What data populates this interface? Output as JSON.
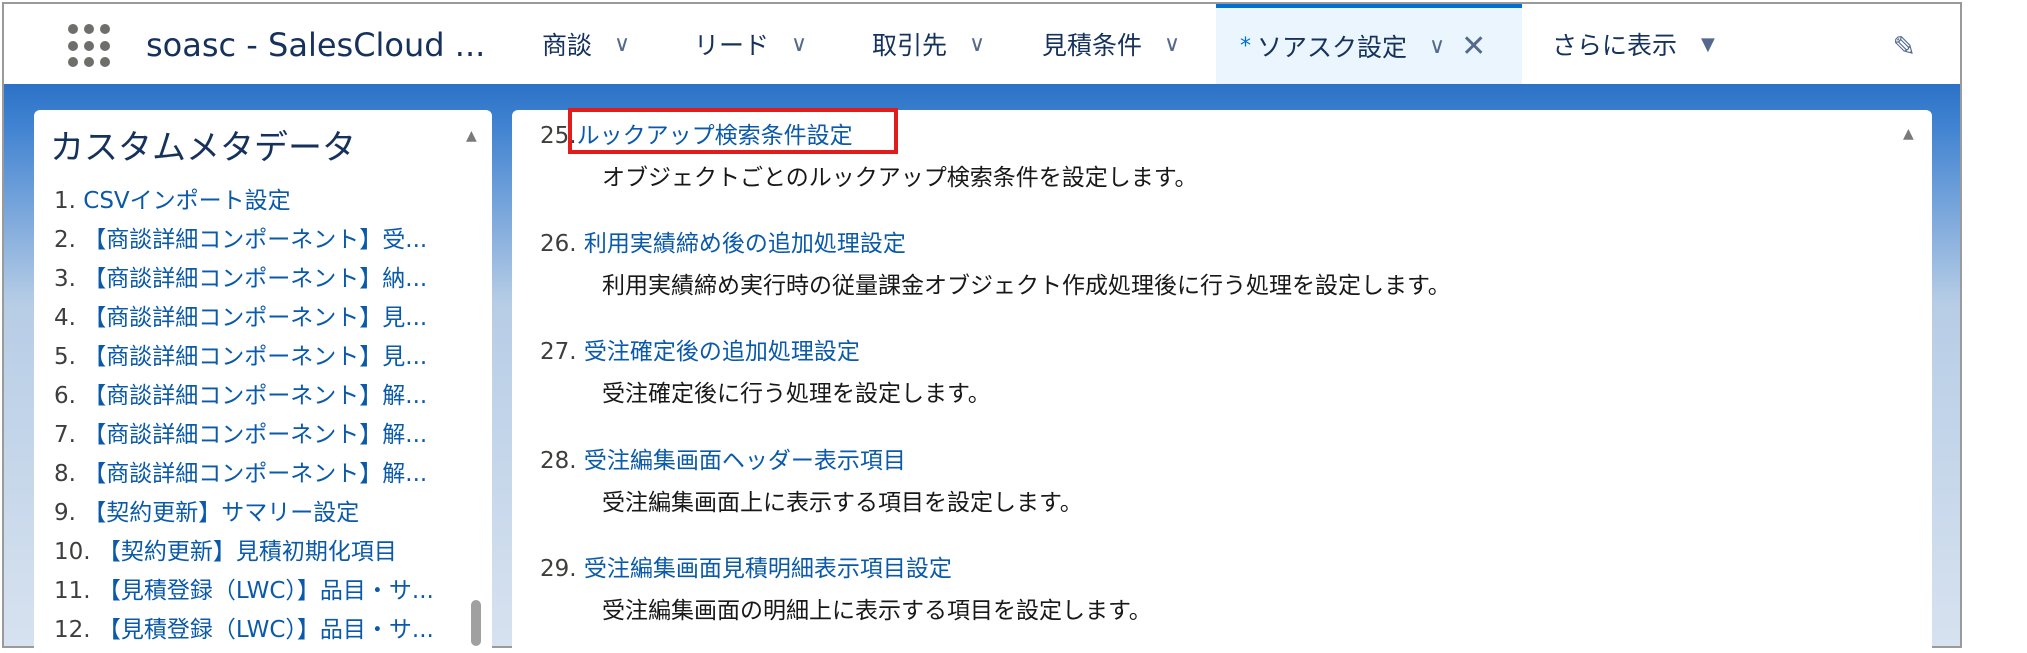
{
  "app": {
    "name": "soasc - SalesCloud ..."
  },
  "tabs": [
    {
      "label": "商談"
    },
    {
      "label": "リード"
    },
    {
      "label": "取引先"
    },
    {
      "label": "見積条件"
    }
  ],
  "active_tab": {
    "marker": "*",
    "label": "ソアスク設定",
    "close": "✕"
  },
  "more_tab": {
    "label": "さらに表示"
  },
  "left": {
    "title": "カスタムメタデータ",
    "items": [
      {
        "num": "1.",
        "label": "CSVインポート設定"
      },
      {
        "num": "2.",
        "label": "【商談詳細コンポーネント】受..."
      },
      {
        "num": "3.",
        "label": "【商談詳細コンポーネント】納..."
      },
      {
        "num": "4.",
        "label": "【商談詳細コンポーネント】見..."
      },
      {
        "num": "5.",
        "label": "【商談詳細コンポーネント】見..."
      },
      {
        "num": "6.",
        "label": "【商談詳細コンポーネント】解..."
      },
      {
        "num": "7.",
        "label": "【商談詳細コンポーネント】解..."
      },
      {
        "num": "8.",
        "label": "【商談詳細コンポーネント】解..."
      },
      {
        "num": "9.",
        "label": "【契約更新】サマリー設定"
      },
      {
        "num": "10.",
        "label": "【契約更新】見積初期化項目"
      },
      {
        "num": "11.",
        "label": "【見積登録（LWC）】品目・サ..."
      },
      {
        "num": "12.",
        "label": "【見積登録（LWC）】品目・サ..."
      }
    ]
  },
  "entries": [
    {
      "num": "25.",
      "label": "ルックアップ検索条件設定",
      "desc": "オブジェクトごとのルックアップ検索条件を設定します。"
    },
    {
      "num": "26.",
      "label": "利用実績締め後の追加処理設定",
      "desc": "利用実績締め実行時の従量課金オブジェクト作成処理後に行う処理を設定します。"
    },
    {
      "num": "27.",
      "label": "受注確定後の追加処理設定",
      "desc": "受注確定後に行う処理を設定します。"
    },
    {
      "num": "28.",
      "label": "受注編集画面ヘッダー表示項目",
      "desc": "受注編集画面上に表示する項目を設定します。"
    },
    {
      "num": "29.",
      "label": "受注編集画面見積明細表示項目設定",
      "desc": "受注編集画面の明細上に表示する項目を設定します。"
    }
  ],
  "colors": {
    "accent": "#0070d2",
    "link": "#0a5aa9",
    "highlight": "#e21b1b"
  }
}
